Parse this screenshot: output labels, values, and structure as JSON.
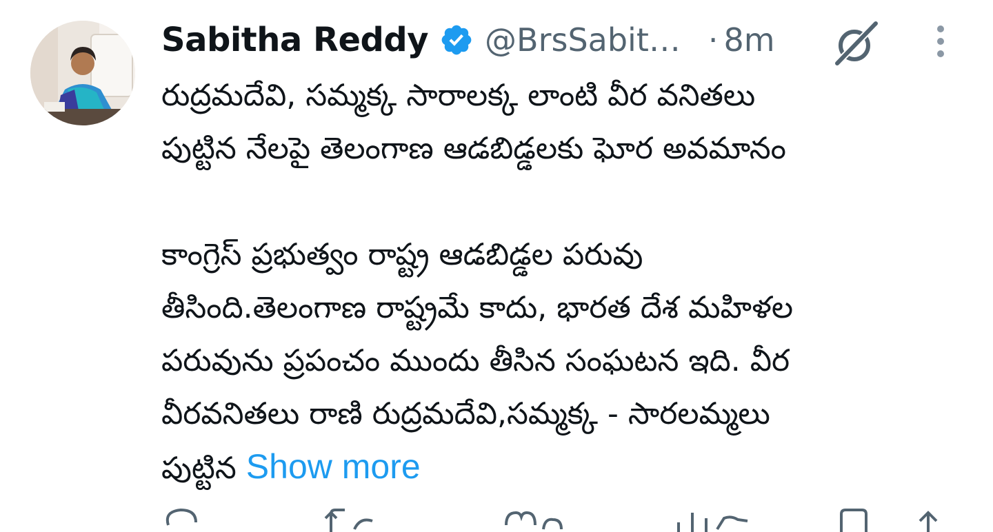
{
  "tweet": {
    "author_name": "Sabitha Reddy",
    "handle": "@BrsSabit…",
    "separator": "·",
    "time": "8m",
    "lines": [
      "రుద్రమదేవి, సమ్మక్క సారాలక్క లాంటి వీర వనితలు",
      "పుట్టిన నేలపై తెలంగాణ ఆడబిడ్డలకు ఘోర అవమానం",
      "",
      "కాంగ్రెస్ ప్రభుత్వం  రాష్ట్ర ఆడబిడ్డల పరువు",
      "తీసింది.తెలంగాణ రాష్ట్రమే కాదు, భారత దేశ మహిళల",
      "పరువును ప్రపంచం ముందు  తీసిన సంఘటన ఇది.  వీర",
      "వీరవనితలు రాణి రుద్రమదేవి,సమ్మక్క - సారలమ్మలు"
    ],
    "last_line": "పుట్టిన",
    "show_more": "Show more"
  },
  "icons": {
    "verified": "verified-badge-icon",
    "grok": "grok-icon",
    "more": "more-vertical-icon",
    "reply": "reply-icon",
    "retweet": "retweet-icon",
    "like": "like-icon",
    "views": "views-icon",
    "bookmark": "bookmark-icon",
    "share": "share-icon"
  },
  "colors": {
    "text": "#0f1419",
    "secondary": "#536471",
    "link": "#1d9bf0",
    "verified": "#1d9bf0"
  }
}
